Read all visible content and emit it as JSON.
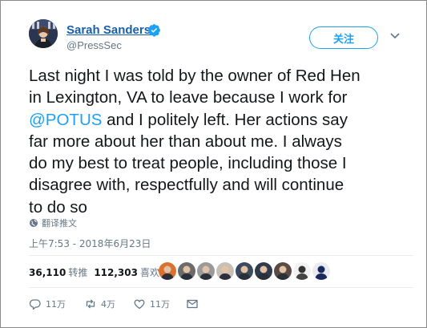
{
  "author": {
    "name": "Sarah Sanders",
    "handle": "@PressSec",
    "verified": true,
    "avatar_icon": "profile-photo"
  },
  "follow_label": "关注",
  "tweet": {
    "lines": [
      [
        {
          "t": "Last night I was told by the owner of Red Hen"
        }
      ],
      [
        {
          "t": "in Lexington, VA to leave because I work for"
        }
      ],
      [
        {
          "t": "@POTUS",
          "mention": true
        },
        {
          "t": " and I politely left. Her actions say"
        }
      ],
      [
        {
          "t": "far more about her than about me. I always"
        }
      ],
      [
        {
          "t": "do my best to treat people, including those I"
        }
      ],
      [
        {
          "t": "disagree with, respectfully and will continue"
        }
      ],
      [
        {
          "t": "to do so"
        }
      ]
    ]
  },
  "translate_label": "翻译推文",
  "timestamp": "上午7:53 - 2018年6月23日",
  "stats": {
    "retweets_count": "36,110",
    "retweets_label": "转推",
    "likes_count": "112,303",
    "likes_label": "喜欢"
  },
  "likers": [
    {
      "icon": "liker-avatar-1",
      "color": "#d9722e"
    },
    {
      "icon": "liker-avatar-2",
      "color": "#6b6b6b"
    },
    {
      "icon": "liker-avatar-3",
      "color": "#9a9a9a"
    },
    {
      "icon": "liker-avatar-4",
      "color": "#c9c0b5"
    },
    {
      "icon": "liker-avatar-5",
      "color": "#3b4a5e"
    },
    {
      "icon": "liker-avatar-6",
      "color": "#2f3a4d"
    },
    {
      "icon": "liker-avatar-7",
      "color": "#5a4a45"
    },
    {
      "icon": "liker-avatar-8",
      "color": "#f2f2f2"
    },
    {
      "icon": "liker-avatar-9",
      "color": "#e9eaf2"
    }
  ],
  "actions": {
    "reply_count": "11万",
    "retweet_count": "4万",
    "like_count": "11万"
  },
  "colors": {
    "link": "#1da1f2",
    "name": "#1a5fa8",
    "muted": "#657786"
  }
}
